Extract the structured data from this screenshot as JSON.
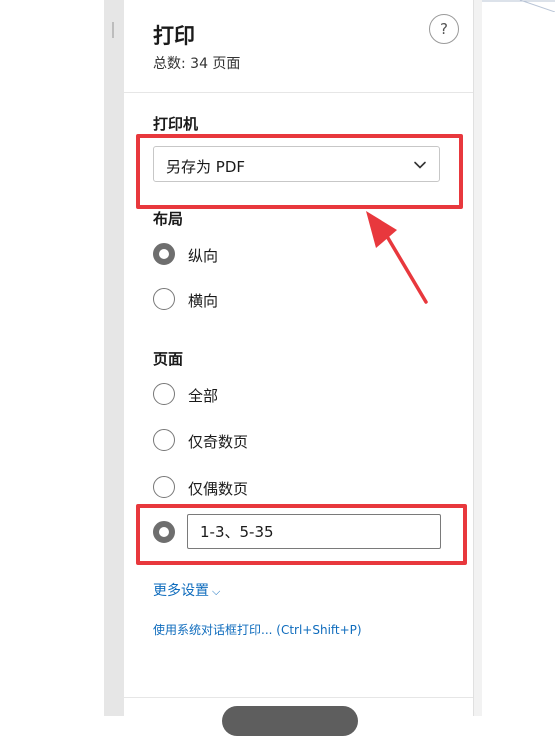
{
  "dialog": {
    "title": "打印",
    "total": "总数: 34 页面",
    "help_label": "?"
  },
  "printer": {
    "label": "打印机",
    "selected": "另存为 PDF"
  },
  "layout": {
    "label": "布局",
    "options": [
      {
        "label": "纵向",
        "selected": true
      },
      {
        "label": "横向",
        "selected": false
      }
    ]
  },
  "pages": {
    "label": "页面",
    "options": [
      {
        "label": "全部",
        "selected": false
      },
      {
        "label": "仅奇数页",
        "selected": false
      },
      {
        "label": "仅偶数页",
        "selected": false
      }
    ],
    "custom_selected": true,
    "custom_value": "1-3、5-35"
  },
  "links": {
    "more_settings": "更多设置",
    "system_dialog": "使用系统对话框打印... (Ctrl+Shift+P)"
  },
  "colors": {
    "annotation": "#e8383d",
    "link": "#0f6cbd"
  }
}
